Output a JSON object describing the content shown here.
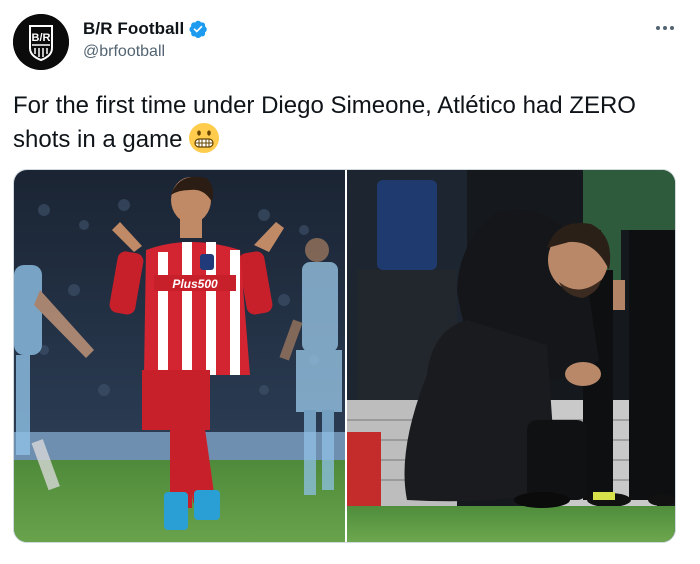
{
  "account": {
    "display_name": "B/R Football",
    "handle": "@brfootball",
    "avatar_logo": "B/R"
  },
  "tweet": {
    "text": "For the first time under Diego Simeone, Atlético had ZERO shots in a game"
  },
  "icons": {
    "verified": "verified-badge-icon",
    "more": "more-options-icon",
    "emoji": "grimacing-face-emoji"
  },
  "media": {
    "left_photo": "player-in-red-white-striped-kit-looking-up",
    "right_photo": "coach-crouching-on-touchline",
    "jersey_sponsor": "Plus500"
  },
  "colors": {
    "verified_blue": "#1d9bf0",
    "text_primary": "#0f1419",
    "text_secondary": "#536471",
    "border": "#cfd9de"
  }
}
